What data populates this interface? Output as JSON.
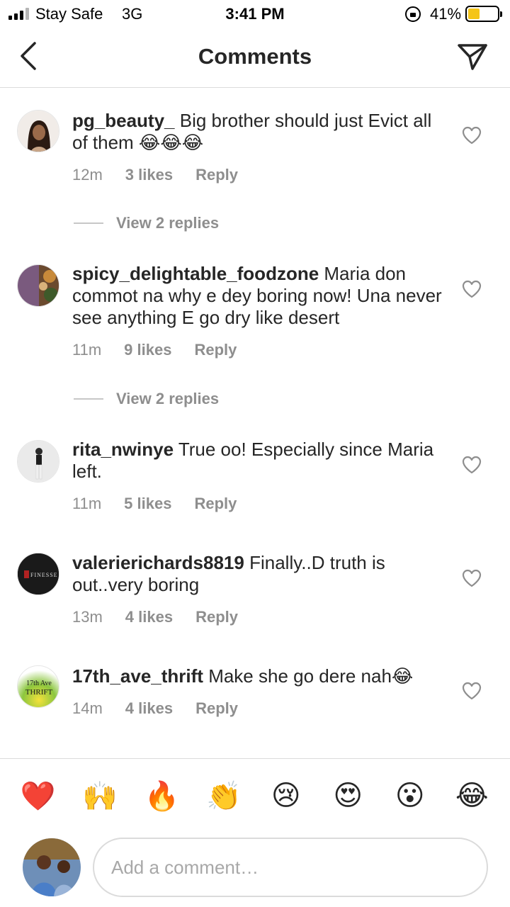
{
  "status_bar": {
    "carrier": "Stay Safe",
    "network": "3G",
    "time": "3:41 PM",
    "battery_percent": "41%",
    "battery_level": 0.41,
    "battery_color": "#f5c518"
  },
  "header": {
    "title": "Comments",
    "back_icon": "chevron-left-icon",
    "share_icon": "paper-plane-icon"
  },
  "comments": [
    {
      "username": "pg_beauty_",
      "text": " Big brother should just Evict all of them 😂😂😂",
      "time": "12m",
      "likes": "3 likes",
      "reply": "Reply",
      "view_replies": "View 2 replies"
    },
    {
      "username": "spicy_delightable_foodzone",
      "text": " Maria don commot na why e dey boring now! Una never see anything E go dry like desert",
      "time": "11m",
      "likes": "9 likes",
      "reply": "Reply",
      "view_replies": "View 2 replies"
    },
    {
      "username": "rita_nwinye",
      "text": " True oo! Especially since Maria left.",
      "time": "11m",
      "likes": "5 likes",
      "reply": "Reply"
    },
    {
      "username": "valerierichards8819",
      "text": " Finally..D truth is out..very boring",
      "time": "13m",
      "likes": "4 likes",
      "reply": "Reply",
      "avatar_text": "FINESSE"
    },
    {
      "username": "17th_ave_thrift",
      "text": " Make she go dere nah😂",
      "time": "14m",
      "likes": "4 likes",
      "reply": "Reply",
      "avatar_text_1": "17th Ave",
      "avatar_text_2": "THRIFT"
    }
  ],
  "emoji_bar": [
    "❤️",
    "🙌",
    "🔥",
    "👏",
    "😢",
    "😍",
    "😮",
    "😂"
  ],
  "composer": {
    "placeholder": "Add a comment…"
  },
  "colors": {
    "text": "#262626",
    "meta": "#8e8e8e",
    "divider": "#dbdbdb"
  }
}
